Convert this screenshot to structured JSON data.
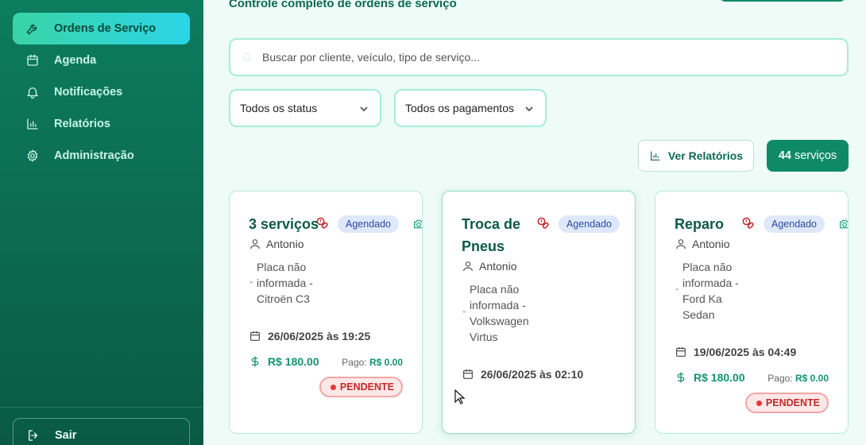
{
  "sidebar": {
    "items": [
      {
        "label": "Ordens de Serviço",
        "icon": "wrench-icon",
        "active": true
      },
      {
        "label": "Agenda",
        "icon": "calendar-icon"
      },
      {
        "label": "Notificações",
        "icon": "bell-icon"
      },
      {
        "label": "Relatórios",
        "icon": "bar-chart-icon"
      },
      {
        "label": "Administração",
        "icon": "gear-icon"
      }
    ],
    "logout_label": "Sair"
  },
  "header": {
    "subtitle": "Controle completo de ordens de serviço"
  },
  "search": {
    "placeholder": "Buscar por cliente, veículo, tipo de serviço..."
  },
  "filters": {
    "status": "Todos os status",
    "payment": "Todos os pagamentos"
  },
  "toolbar": {
    "reports_label": "Ver Relatórios",
    "count_number": "44",
    "count_suffix": "serviços"
  },
  "cards": [
    {
      "title": "3 serviços",
      "badge": "Agendado",
      "client": "Antonio",
      "vehicle_lines": [
        "Placa não",
        "informada -",
        "Citroën C3"
      ],
      "date": "26/06/2025 às 19:25",
      "price": "R$ 180.00",
      "paid_label": "Pago:",
      "paid_value": "R$ 0.00",
      "status": "PENDENTE"
    },
    {
      "title_lines": [
        "Troca de",
        "Pneus"
      ],
      "badge": "Agendado",
      "client": "Antonio",
      "vehicle_lines": [
        "Placa não",
        "informada -",
        "Volkswagen",
        "Virtus"
      ],
      "date": "26/06/2025 às 02:10"
    },
    {
      "title": "Reparo",
      "badge": "Agendado",
      "client": "Antonio",
      "vehicle_lines": [
        "Placa não",
        "informada -",
        "Ford Ka",
        "Sedan"
      ],
      "date": "19/06/2025 às 04:49",
      "price": "R$ 180.00",
      "paid_label": "Pago:",
      "paid_value": "R$ 0.00",
      "status": "PENDENTE"
    }
  ],
  "colors": {
    "brand": "#0f8a68",
    "active_nav_from": "#3ad3a6",
    "active_nav_to": "#2bd5e6",
    "pending": "#c42929",
    "badge_bg": "#dfe8fb"
  }
}
